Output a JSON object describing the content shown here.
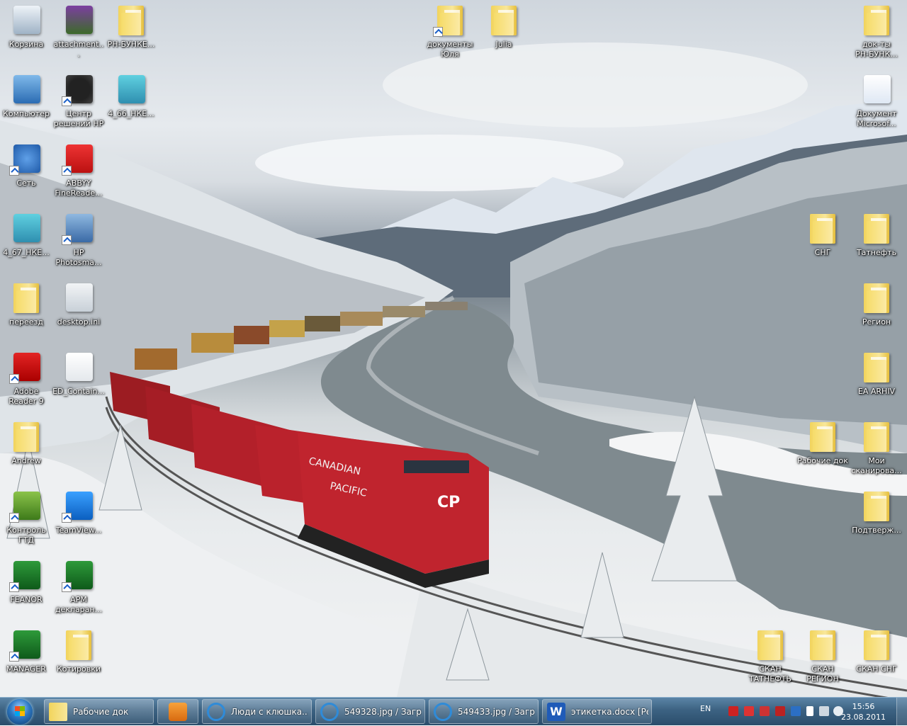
{
  "desktop": {
    "icons": [
      {
        "label": "Корзина",
        "icon": "recycle-bin-icon"
      },
      {
        "label": "attachment...",
        "icon": "winrar-archive-icon"
      },
      {
        "label": "РН-БУНКЕ...",
        "icon": "folder-icon"
      },
      {
        "label": "документы\nЮля",
        "icon": "folder-shortcut-icon"
      },
      {
        "label": "Julia",
        "icon": "user-folder-icon"
      },
      {
        "label": "док-ты\nРН-БУНК...",
        "icon": "folder-icon"
      },
      {
        "label": "Компьютер",
        "icon": "computer-icon"
      },
      {
        "label": "Центр\nрешений HP",
        "icon": "hp-solution-center-icon"
      },
      {
        "label": "4_66_НКЕ...",
        "icon": "archive-file-icon"
      },
      {
        "label": "Документ\nMicrosof...",
        "icon": "word-document-icon"
      },
      {
        "label": "Сеть",
        "icon": "network-icon"
      },
      {
        "label": "ABBYY\nFineReade...",
        "icon": "abbyy-finereader-icon"
      },
      {
        "label": "4_67_НКЕ...",
        "icon": "archive-file-icon"
      },
      {
        "label": "HP\nPhotosma...",
        "icon": "hp-photosmart-icon"
      },
      {
        "label": "СНГ",
        "icon": "folder-icon"
      },
      {
        "label": "Татнефть",
        "icon": "folder-icon"
      },
      {
        "label": "переезд",
        "icon": "folder-icon"
      },
      {
        "label": "desktop.ini",
        "icon": "settings-file-icon"
      },
      {
        "label": "Регион",
        "icon": "folder-icon"
      },
      {
        "label": "Adobe\nReader 9",
        "icon": "adobe-reader-icon"
      },
      {
        "label": "ED_Contain...",
        "icon": "xml-file-icon"
      },
      {
        "label": "EA ARHIV",
        "icon": "folder-icon"
      },
      {
        "label": "Andrew",
        "icon": "folder-icon"
      },
      {
        "label": "Рабочие док",
        "icon": "folder-icon"
      },
      {
        "label": "Мои\nсканирова...",
        "icon": "folder-icon"
      },
      {
        "label": "Контроль\nГТД",
        "icon": "kontrol-gtd-icon"
      },
      {
        "label": "TeamView...",
        "icon": "teamviewer-icon"
      },
      {
        "label": "Подтверж...",
        "icon": "folder-icon"
      },
      {
        "label": "FEANOR",
        "icon": "feanor-app-icon"
      },
      {
        "label": "АРМ\nдекларан...",
        "icon": "arm-declarant-icon"
      },
      {
        "label": "MANAGER",
        "icon": "manager-app-icon"
      },
      {
        "label": "Котировки",
        "icon": "folder-icon"
      },
      {
        "label": "СКАН\nТАТНЕФТЬ",
        "icon": "folder-icon"
      },
      {
        "label": "СКАН\nРЕГИОН",
        "icon": "folder-icon"
      },
      {
        "label": "СКАН СНГ",
        "icon": "folder-icon"
      }
    ]
  },
  "taskbar": {
    "start_icon": "windows-start-orb",
    "buttons": [
      {
        "label": "Рабочие док",
        "icon": "folder-icon"
      },
      {
        "label": "",
        "icon": "media-player-icon"
      },
      {
        "label": "Люди с клюшка...",
        "icon": "internet-explorer-icon"
      },
      {
        "label": "549328.jpg / Загр...",
        "icon": "internet-explorer-icon"
      },
      {
        "label": "549433.jpg / Загр...",
        "icon": "internet-explorer-icon"
      },
      {
        "label": "этикетка.docx [Ре...",
        "icon": "word-icon"
      }
    ],
    "tray": {
      "language": "EN",
      "time": "15:56",
      "date": "23.08.2011"
    }
  },
  "colors": {
    "taskbar_top": "#5b84a6",
    "taskbar_bottom": "#2a4d6b",
    "train_red": "#b3202a",
    "folder_yellow": "#f2d45c"
  }
}
